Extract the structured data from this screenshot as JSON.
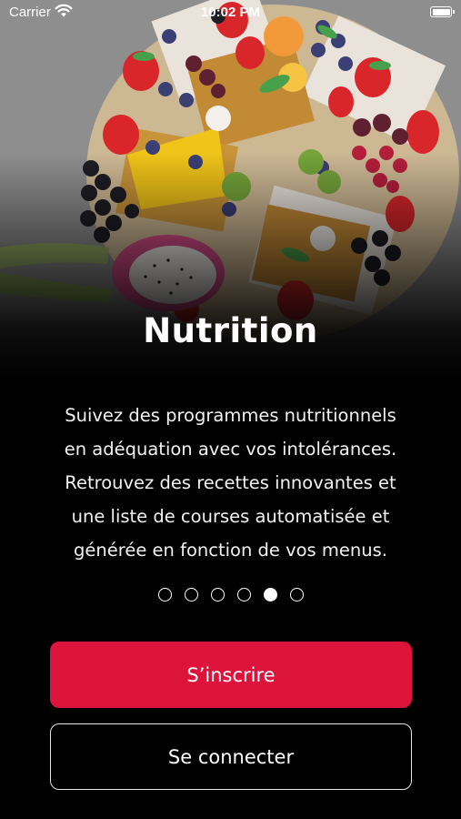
{
  "status_bar": {
    "carrier": "Carrier",
    "time": "10:02 PM"
  },
  "onboarding": {
    "title": "Nutrition",
    "description_lines": [
      "Suivez des programmes nutritionnels",
      "en adéquation avec vos intolérances.",
      "Retrouvez des recettes innovantes et",
      "une liste de courses automatisée et",
      "générée en fonction de vos menus."
    ],
    "page_count": 6,
    "current_page": 5
  },
  "actions": {
    "signup_label": "S’inscrire",
    "login_label": "Se connecter"
  },
  "colors": {
    "accent": "#dc143c",
    "background": "#000000"
  }
}
